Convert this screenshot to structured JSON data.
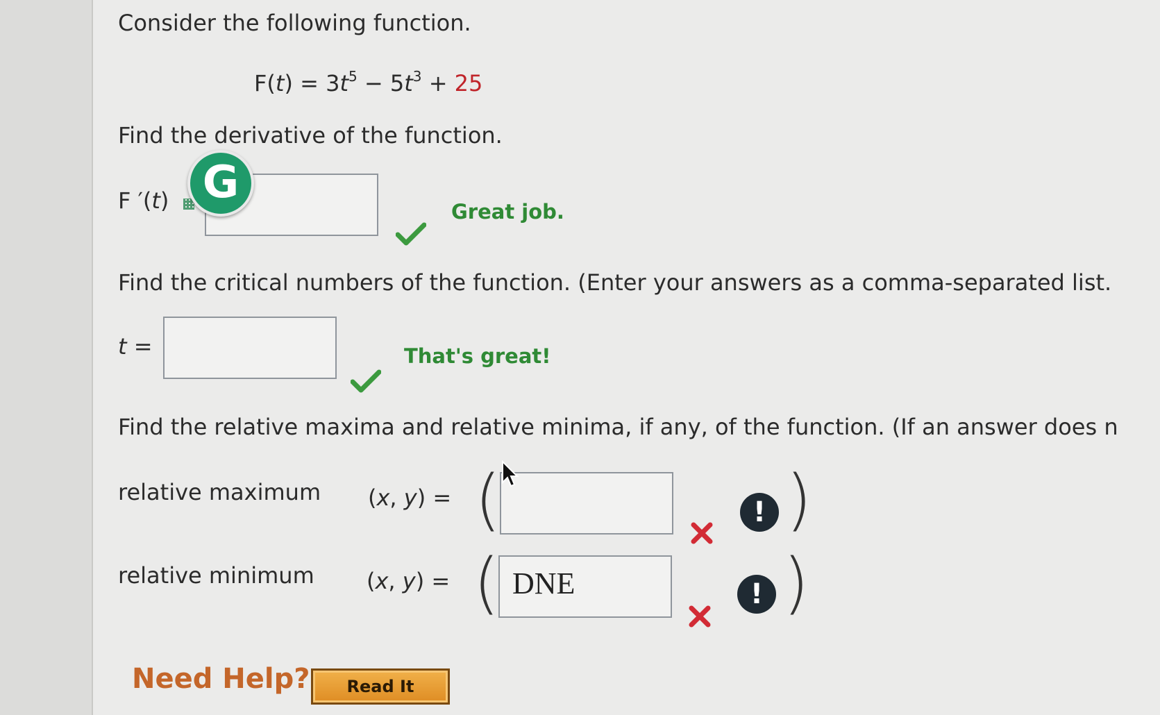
{
  "intro": "Consider the following function.",
  "function_display": {
    "name": "F(",
    "var": "t",
    "close": ") = 3",
    "t1": "t",
    "exp1": "5",
    "minus": " − 5",
    "t2": "t",
    "exp2": "3",
    "plus": " + ",
    "constant": "25"
  },
  "q1": {
    "prompt": "Find the derivative of the function.",
    "label_main": "F ′(",
    "label_var": "t",
    "label_close": ")",
    "answer_value": "",
    "feedback": "Great job.",
    "status_icon": "check-icon",
    "badge_letter": "G"
  },
  "q2": {
    "prompt": "Find the critical numbers of the function. (Enter your answers as a comma-separated list.",
    "label_var": "t",
    "label_eq": " =",
    "answer_value": "",
    "feedback": "That's great!",
    "status_icon": "check-icon"
  },
  "q3": {
    "prompt": "Find the relative maxima and relative minima, if any, of the function. (If an answer does n",
    "max_label": "relative maximum",
    "min_label": "relative minimum",
    "xy_open": "(",
    "xy_x": "x",
    "xy_comma": ", ",
    "xy_y": "y",
    "xy_close": ") =",
    "max_value": "",
    "min_value": "DNE",
    "warn_symbol": "!",
    "status_icon": "x-icon"
  },
  "help": {
    "label": "Need Help?",
    "read_button": "Read It"
  },
  "colors": {
    "correct": "#2f8a35",
    "incorrect": "#d22b35",
    "constant_red": "#c0242a",
    "need_help": "#c4662a",
    "button": "#e39a2f"
  }
}
